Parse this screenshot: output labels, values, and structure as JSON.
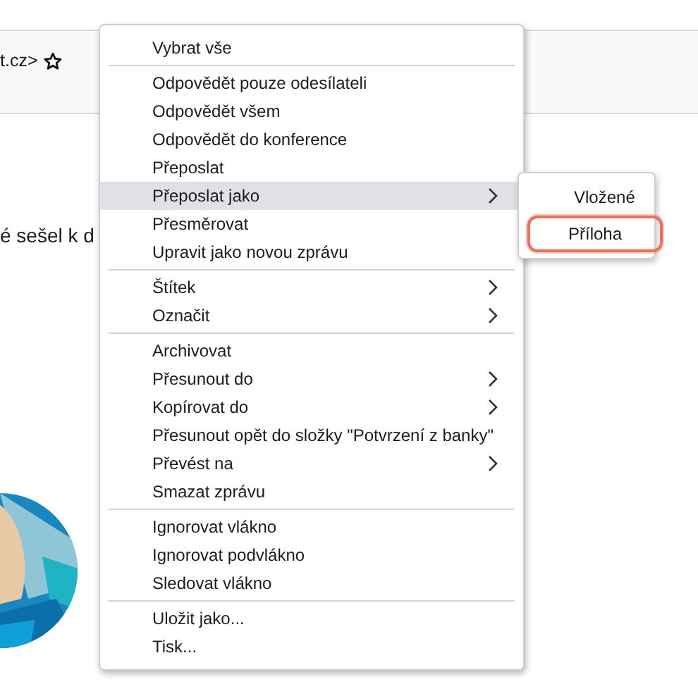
{
  "header": {
    "address": "t.cz>"
  },
  "body": {
    "text": "é sešel k d"
  },
  "menu": {
    "items": [
      {
        "kind": "item",
        "label": "Vybrat vše",
        "submenu": false,
        "selected": false
      },
      {
        "kind": "separator"
      },
      {
        "kind": "item",
        "label": "Odpovědět pouze odesílateli",
        "submenu": false,
        "selected": false
      },
      {
        "kind": "item",
        "label": "Odpovědět všem",
        "submenu": false,
        "selected": false
      },
      {
        "kind": "item",
        "label": "Odpovědět do konference",
        "submenu": false,
        "selected": false
      },
      {
        "kind": "item",
        "label": "Přeposlat",
        "submenu": false,
        "selected": false
      },
      {
        "kind": "item",
        "label": "Přeposlat jako",
        "submenu": true,
        "selected": true
      },
      {
        "kind": "item",
        "label": "Přesměrovat",
        "submenu": false,
        "selected": false
      },
      {
        "kind": "item",
        "label": "Upravit jako novou zprávu",
        "submenu": false,
        "selected": false
      },
      {
        "kind": "separator"
      },
      {
        "kind": "item",
        "label": "Štítek",
        "submenu": true,
        "selected": false
      },
      {
        "kind": "item",
        "label": "Označit",
        "submenu": true,
        "selected": false
      },
      {
        "kind": "separator"
      },
      {
        "kind": "item",
        "label": "Archivovat",
        "submenu": false,
        "selected": false
      },
      {
        "kind": "item",
        "label": "Přesunout do",
        "submenu": true,
        "selected": false
      },
      {
        "kind": "item",
        "label": "Kopírovat do",
        "submenu": true,
        "selected": false
      },
      {
        "kind": "item",
        "label": "Přesunout opět do složky \"Potvrzení z banky\"",
        "submenu": false,
        "selected": false
      },
      {
        "kind": "item",
        "label": "Převést na",
        "submenu": true,
        "selected": false
      },
      {
        "kind": "item",
        "label": "Smazat zprávu",
        "submenu": false,
        "selected": false
      },
      {
        "kind": "separator"
      },
      {
        "kind": "item",
        "label": "Ignorovat vlákno",
        "submenu": false,
        "selected": false
      },
      {
        "kind": "item",
        "label": "Ignorovat podvlákno",
        "submenu": false,
        "selected": false
      },
      {
        "kind": "item",
        "label": "Sledovat vlákno",
        "submenu": false,
        "selected": false
      },
      {
        "kind": "separator"
      },
      {
        "kind": "item",
        "label": "Uložit jako...",
        "submenu": false,
        "selected": false
      },
      {
        "kind": "item",
        "label": "Tisk...",
        "submenu": false,
        "selected": false
      }
    ]
  },
  "submenu": {
    "items": [
      {
        "label": "Vložené",
        "highlighted": false
      },
      {
        "label": "Příloha",
        "highlighted": true
      }
    ]
  }
}
